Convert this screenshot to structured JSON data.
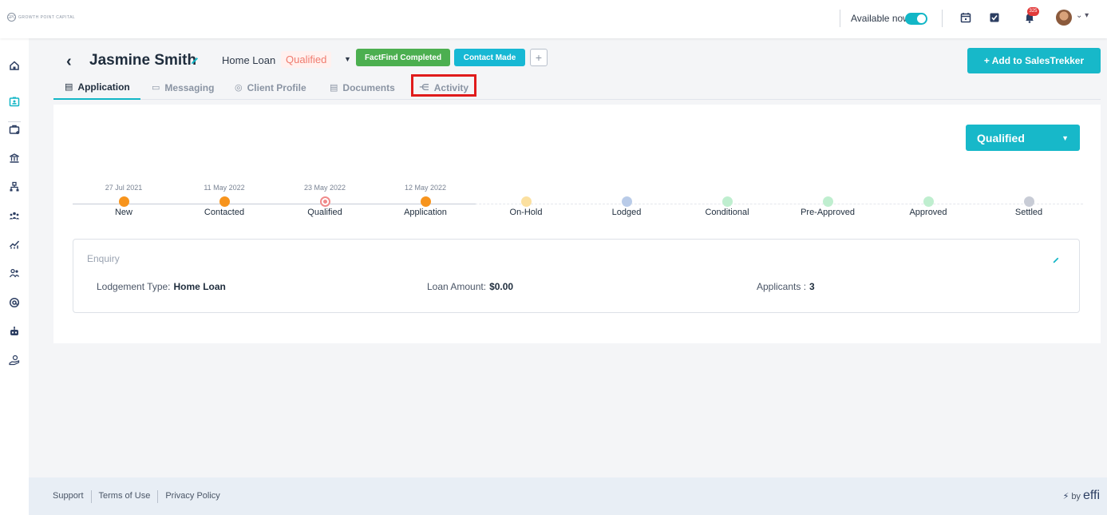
{
  "brand": {
    "logo_text": "GROWTH POINT CAPITAL",
    "logo_mark": "GPC"
  },
  "topbar": {
    "availability_label": "Available now",
    "notification_count": "325"
  },
  "header": {
    "back_icon": "chevron-left",
    "client_name": "Jasmine Smith",
    "loan_type": "Home Loan",
    "status": "Qualified",
    "tag_factfind": "FactFind Completed",
    "tag_contact": "Contact Made",
    "add_tag": "+",
    "add_button": "+ Add to SalesTrekker"
  },
  "tabs": [
    {
      "label": "Application",
      "icon": "clipboard-icon"
    },
    {
      "label": "Messaging",
      "icon": "message-icon"
    },
    {
      "label": "Client Profile",
      "icon": "user-circle-icon"
    },
    {
      "label": "Documents",
      "icon": "documents-icon"
    },
    {
      "label": "Activity",
      "icon": "activity-icon"
    }
  ],
  "stage_dropdown": {
    "value": "Qualified"
  },
  "timeline": [
    {
      "label": "New",
      "date": "27 Jul 2021",
      "color": "#f7941d"
    },
    {
      "label": "Contacted",
      "date": "11 May 2022",
      "color": "#f7941d"
    },
    {
      "label": "Qualified",
      "date": "23 May 2022",
      "color": "#f08a8a",
      "current": true
    },
    {
      "label": "Application",
      "date": "12 May 2022",
      "color": "#f7941d"
    },
    {
      "label": "On-Hold",
      "date": "",
      "color": "#fbe0a0"
    },
    {
      "label": "Lodged",
      "date": "",
      "color": "#b9cbe8"
    },
    {
      "label": "Conditional",
      "date": "",
      "color": "#bfeecf"
    },
    {
      "label": "Pre-Approved",
      "date": "",
      "color": "#bfeecf"
    },
    {
      "label": "Approved",
      "date": "",
      "color": "#bfeecf"
    },
    {
      "label": "Settled",
      "date": "",
      "color": "#c8ccd6"
    }
  ],
  "enquiry": {
    "title": "Enquiry",
    "lodgement_label": "Lodgement Type:",
    "lodgement_value": "Home Loan",
    "loan_amount_label": "Loan Amount:",
    "loan_amount_value": "$0.00",
    "applicants_label": "Applicants :",
    "applicants_value": "3"
  },
  "footer": {
    "links": [
      "Support",
      "Terms of Use",
      "Privacy Policy"
    ],
    "powered_prefix": "by",
    "powered_brand": "effi"
  },
  "colors": {
    "accent": "#12b6c6",
    "success": "#4caf50",
    "danger": "#e01b1b"
  }
}
